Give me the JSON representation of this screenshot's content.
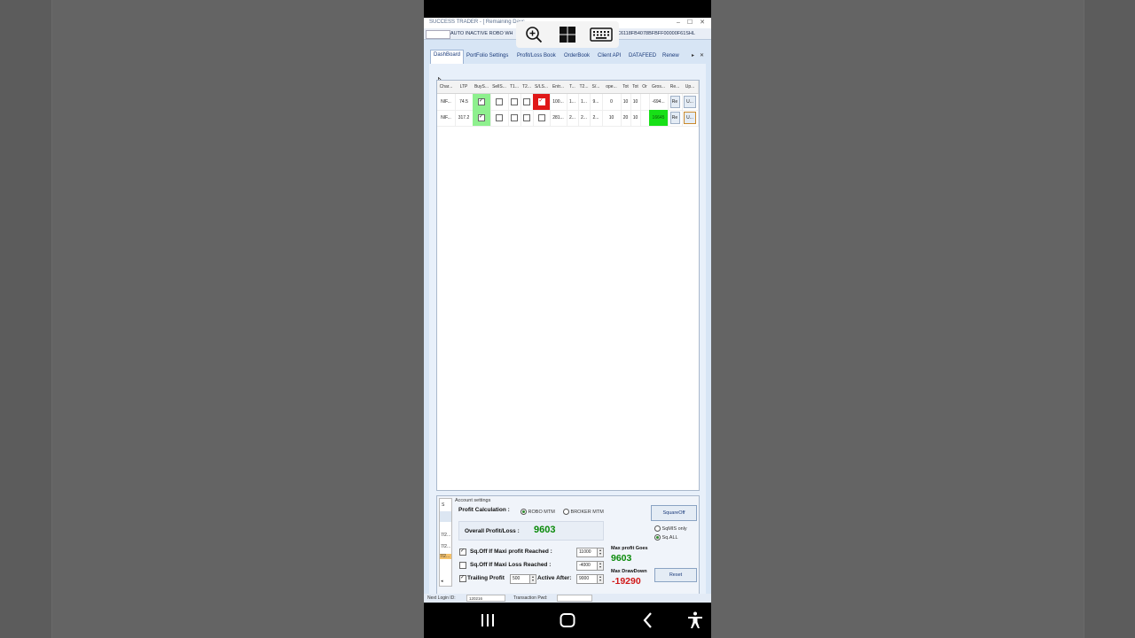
{
  "window": {
    "title": "SUCCESS TRADER - [ Remaining Days",
    "controls": [
      "‒",
      "☐",
      "✕"
    ]
  },
  "robo_bar": {
    "label": "AUTO INACTIVE ROBO WH",
    "license_key": "C6118FB4078BFBFF00000F61SHL"
  },
  "tabs": [
    {
      "label": "DashBoard",
      "active": true
    },
    {
      "label": "PortFolio Settings"
    },
    {
      "label": "Profit/Loss Book"
    },
    {
      "label": "OrderBook"
    },
    {
      "label": "Client API"
    },
    {
      "label": "DATAFEED"
    },
    {
      "label": "Renew"
    }
  ],
  "tab_controls": {
    "more": "▸",
    "close": "✕"
  },
  "grid": {
    "headers": [
      "Char...",
      "LTP",
      "BuyS...",
      "SellS...",
      "T1...",
      "T2...",
      "S/LS...",
      "Entr...",
      "T...",
      "T2...",
      "S/...",
      "ope...",
      "Tot",
      "Tot",
      "Or",
      "Gros...",
      "Re...",
      "Up..."
    ],
    "rows": [
      {
        "symbol": "NIF...",
        "ltp": "74.5",
        "buy": true,
        "sell": false,
        "t1": false,
        "t2": false,
        "sl": true,
        "entry": "100...",
        "t": "1...",
        "t2v": "1...",
        "s": "9...",
        "open": "0",
        "tot1": "10",
        "tot2": "10",
        "or": "",
        "gross": "-694...",
        "re": "Re",
        "up": "U..."
      },
      {
        "symbol": "NIF...",
        "ltp": "317.2",
        "buy": true,
        "sell": false,
        "t1": false,
        "t2": false,
        "sl": false,
        "entry": "281...",
        "t": "2...",
        "t2v": "2...",
        "s": "2...",
        "open": "10",
        "tot1": "20",
        "tot2": "10",
        "or": "",
        "gross": "16645",
        "re": "Re",
        "up": "U..."
      }
    ],
    "colors": {
      "buy_bg": "#8ef08e",
      "sl_bg": "#e01818",
      "gross_positive_bg": "#17e017"
    }
  },
  "bottom_panel": {
    "list_header": "S",
    "list_items": [
      "7/2...",
      "7/2...",
      "7/2..."
    ],
    "account_settings_label": "Account settings",
    "profit_calculation_label": "Profit Calculation :",
    "robo_mtm_label": "ROBO MTM",
    "broker_mtm_label": "BROKER MTM",
    "square_off_label": "SquareOff",
    "sqmis_label": "SqMIS only",
    "sqall_label": "Sq.ALL",
    "overall_pl_label": "Overall Profit/Loss :",
    "overall_pl_value": "9603",
    "max_profit_label": "Sq.Off If Maxi profit Reached :",
    "max_profit_value": "11000",
    "max_loss_label": "Sq.Off If Maxi Loss Reached :",
    "max_loss_value": "-4000",
    "trailing_label": "Trailing Profit",
    "trailing_value": "500",
    "active_after_label": "Active After:",
    "active_after_value": "9000",
    "max_profit_goes_label": "Max profit Goes",
    "max_profit_goes_value": "9603",
    "max_drawdown_label": "Max DrawDown",
    "max_drawdown_value": "-19290",
    "reset_label": "Reset"
  },
  "status_bar": {
    "left": "Next Login ID:",
    "left_value": "120216",
    "right": "Transaction Pwd:"
  },
  "colors": {
    "profit_green": "#0a8a0a",
    "loss_red": "#d01818",
    "accent_blue": "#1a3a7a"
  }
}
